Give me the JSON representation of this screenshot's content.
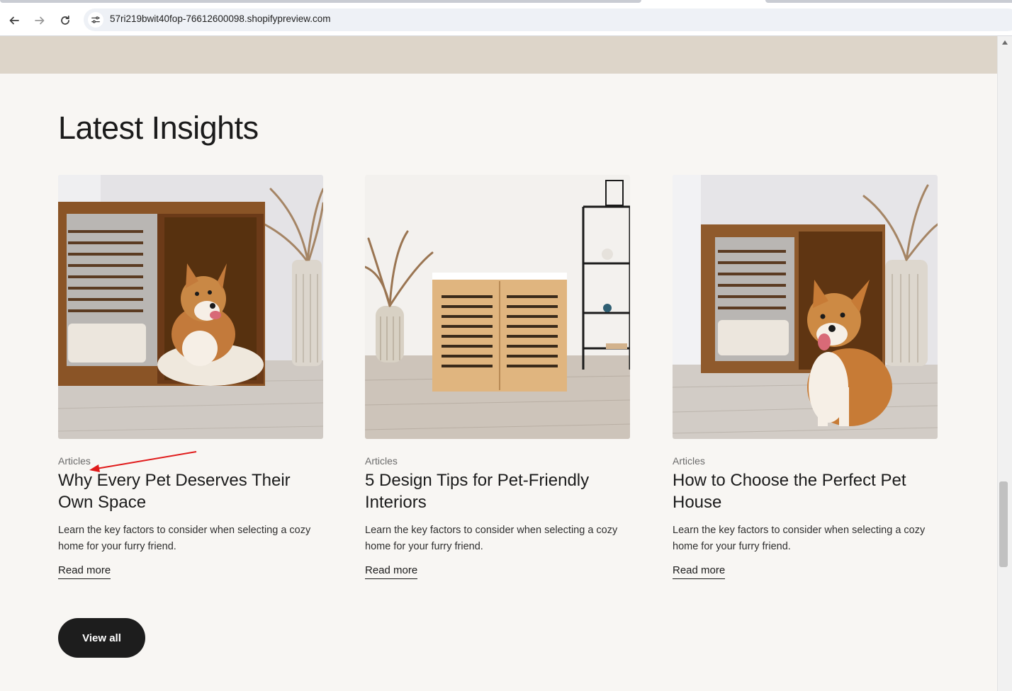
{
  "browser": {
    "url": "57ri219bwit40fop-76612600098.shopifypreview.com",
    "icons": {
      "back": "arrow-left-icon",
      "forward": "arrow-right-icon",
      "reload": "reload-icon",
      "site_info": "tune-icon"
    }
  },
  "section": {
    "heading": "Latest Insights",
    "articles": [
      {
        "category": "Articles",
        "title": "Why Every Pet Deserves Their Own Space",
        "description": "Learn the key factors to consider when selecting a cozy home for your furry friend.",
        "link": "Read more",
        "image": "corgi-lying-in-wooden-dog-house"
      },
      {
        "category": "Articles",
        "title": "5 Design Tips for Pet-Friendly Interiors",
        "description": "Learn the key factors to consider when selecting a cozy home for your furry friend.",
        "link": "Read more",
        "image": "wooden-slatted-pet-cabinet-with-shelf"
      },
      {
        "category": "Articles",
        "title": "How to Choose the Perfect Pet House",
        "description": "Learn the key factors to consider when selecting a cozy home for your furry friend.",
        "link": "Read more",
        "image": "corgi-sitting-by-wooden-dog-house"
      }
    ],
    "view_all": "View all"
  },
  "colors": {
    "page_bg": "#f8f6f3",
    "band_bg": "#ddd5c9",
    "text": "#1b1b1b",
    "button_bg": "#1d1d1d",
    "annotation_arrow": "#e01b1b"
  }
}
